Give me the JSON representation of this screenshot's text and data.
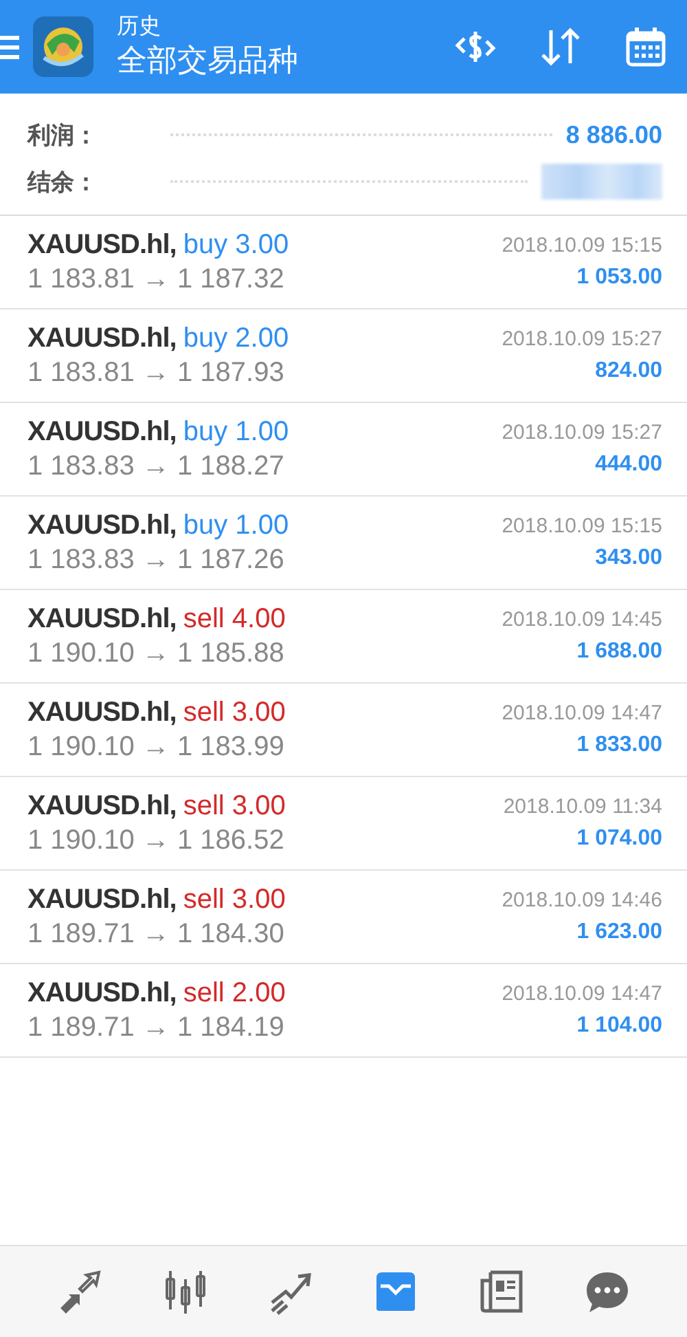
{
  "header": {
    "title": "历史",
    "subtitle": "全部交易品种"
  },
  "summary": [
    {
      "label": "利润：",
      "value": "8 886.00",
      "blurred": false
    },
    {
      "label": "结余：",
      "blurred": true
    }
  ],
  "trades": [
    {
      "symbol": "XAUUSD.hl,",
      "kind": "buy",
      "order": "buy 3.00",
      "prices": "1 183.81 → 1 187.32",
      "time": "2018.10.09 15:15",
      "profit": "1 053.00"
    },
    {
      "symbol": "XAUUSD.hl,",
      "kind": "buy",
      "order": "buy 2.00",
      "prices": "1 183.81 → 1 187.93",
      "time": "2018.10.09 15:27",
      "profit": "824.00"
    },
    {
      "symbol": "XAUUSD.hl,",
      "kind": "buy",
      "order": "buy 1.00",
      "prices": "1 183.83 → 1 188.27",
      "time": "2018.10.09 15:27",
      "profit": "444.00"
    },
    {
      "symbol": "XAUUSD.hl,",
      "kind": "buy",
      "order": "buy 1.00",
      "prices": "1 183.83 → 1 187.26",
      "time": "2018.10.09 15:15",
      "profit": "343.00"
    },
    {
      "symbol": "XAUUSD.hl,",
      "kind": "sell",
      "order": "sell 4.00",
      "prices": "1 190.10 → 1 185.88",
      "time": "2018.10.09 14:45",
      "profit": "1 688.00"
    },
    {
      "symbol": "XAUUSD.hl,",
      "kind": "sell",
      "order": "sell 3.00",
      "prices": "1 190.10 → 1 183.99",
      "time": "2018.10.09 14:47",
      "profit": "1 833.00"
    },
    {
      "symbol": "XAUUSD.hl,",
      "kind": "sell",
      "order": "sell 3.00",
      "prices": "1 190.10 → 1 186.52",
      "time": "2018.10.09 11:34",
      "profit": "1 074.00"
    },
    {
      "symbol": "XAUUSD.hl,",
      "kind": "sell",
      "order": "sell 3.00",
      "prices": "1 189.71 → 1 184.30",
      "time": "2018.10.09 14:46",
      "profit": "1 623.00"
    },
    {
      "symbol": "XAUUSD.hl,",
      "kind": "sell",
      "order": "sell 2.00",
      "prices": "1 189.71 → 1 184.19",
      "time": "2018.10.09 14:47",
      "profit": "1 104.00"
    }
  ],
  "nav": [
    {
      "kind": "trade",
      "selected": false
    },
    {
      "kind": "quotes",
      "selected": false
    },
    {
      "kind": "chart",
      "selected": false
    },
    {
      "kind": "history",
      "selected": true
    },
    {
      "kind": "news",
      "selected": false
    },
    {
      "kind": "chat",
      "selected": false
    }
  ]
}
